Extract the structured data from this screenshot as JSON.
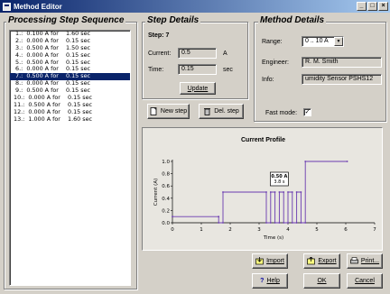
{
  "window": {
    "title": "Method Editor",
    "min": "_",
    "max": "□",
    "close": "×"
  },
  "sequence": {
    "title": "Processing Step Sequence",
    "items": [
      " 1.:  0.100 A for    1.60 sec",
      " 2.:  0.000 A for    0.15 sec",
      " 3.:  0.500 A for    1.50 sec",
      " 4.:  0.000 A for    0.15 sec",
      " 5.:  0.500 A for    0.15 sec",
      " 6.:  0.000 A for    0.15 sec",
      " 7.:  0.500 A for    0.15 sec",
      " 8.:  0.000 A for    0.15 sec",
      " 9.:  0.500 A for    0.15 sec",
      "10.:  0.000 A for    0.15 sec",
      "11.:  0.500 A for    0.15 sec",
      "12.:  0.000 A for    0.15 sec",
      "13.:  1.000 A for    1.60 sec"
    ],
    "selected_index": 6
  },
  "step_details": {
    "title": "Step Details",
    "step_label": "Step: 7",
    "current_label": "Current:",
    "current_value": "0.5",
    "current_unit": "A",
    "time_label": "Time:",
    "time_value": "0.15",
    "time_unit": "sec",
    "update_button": "Update"
  },
  "method_details": {
    "title": "Method Details",
    "range_label": "Range:",
    "range_value": "0 .. 10 A",
    "engineer_label": "Engineer:",
    "engineer_value": "R. M. Smith",
    "info_label": "Info:",
    "info_value": "umidity Sensor PSHS12",
    "fast_mode_label": "Fast mode:",
    "fast_mode_checked": true
  },
  "buttons": {
    "new_step": "New step",
    "del_step": "Del. step",
    "import": "Import",
    "export": "Export",
    "print": "Print...",
    "help": "Help",
    "ok": "OK",
    "cancel": "Cancel"
  },
  "chart_data": {
    "type": "line",
    "title": "Current Profile",
    "xlabel": "Time (s)",
    "ylabel": "Current (A)",
    "xlim": [
      0,
      7
    ],
    "ylim": [
      0,
      1.0
    ],
    "xticks": [
      "0",
      "1",
      "2",
      "3",
      "4",
      "5",
      "6",
      "7"
    ],
    "yticks": [
      "0.0",
      "0.2",
      "0.4",
      "0.6",
      "0.8",
      "1.0"
    ],
    "x": [
      0,
      1.6,
      1.6,
      1.75,
      1.75,
      3.25,
      3.25,
      3.4,
      3.4,
      3.55,
      3.55,
      3.7,
      3.7,
      3.85,
      3.85,
      4.0,
      4.0,
      4.15,
      4.15,
      4.3,
      4.3,
      4.45,
      4.45,
      4.6,
      4.6,
      6.05
    ],
    "y": [
      0.1,
      0.1,
      0.0,
      0.0,
      0.5,
      0.5,
      0.0,
      0.0,
      0.5,
      0.5,
      0.0,
      0.0,
      0.5,
      0.5,
      0.0,
      0.0,
      0.5,
      0.5,
      0.0,
      0.0,
      0.5,
      0.5,
      0.0,
      0.0,
      1.0,
      1.0
    ],
    "highlight": {
      "x": 3.7,
      "y": 0.5,
      "label_line1": "0.50 A",
      "label_line2": "3.8 s"
    },
    "line_color": "#6a3ab0",
    "grid": false
  }
}
